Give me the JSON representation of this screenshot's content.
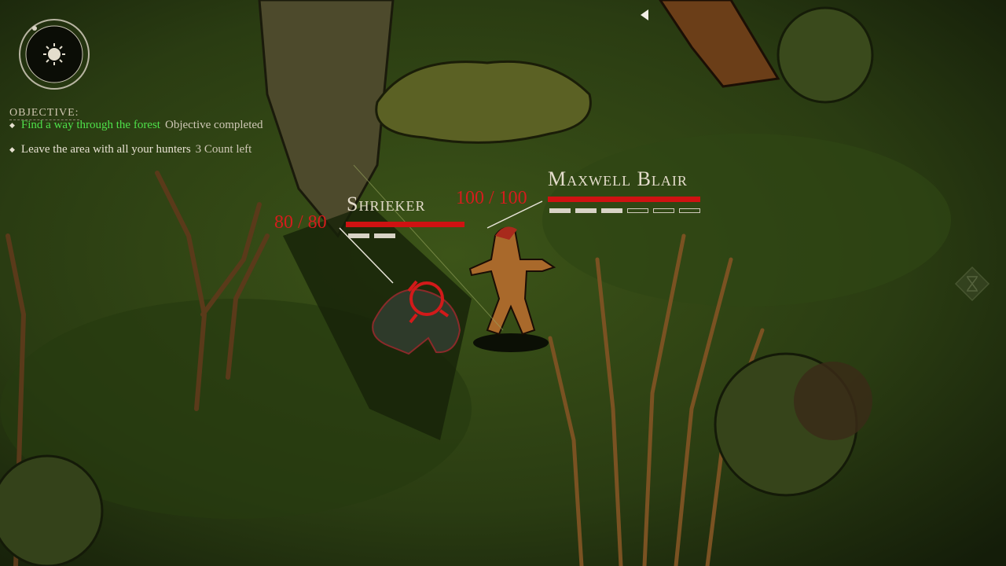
{
  "objectives": {
    "header": "OBJECTIVE:",
    "items": [
      {
        "label": "Find a way through the forest",
        "status": "Objective completed",
        "completed": true
      },
      {
        "label": "Leave the area with all your hunters",
        "status": "3 Count left",
        "completed": false
      }
    ]
  },
  "enemy": {
    "name": "Shrieker",
    "hp_text": "80 / 80",
    "hp": 80,
    "hp_max": 80,
    "action_points": {
      "filled": 2,
      "total": 2
    }
  },
  "hunter": {
    "name": "Maxwell Blair",
    "hp_text": "100 / 100",
    "hp": 100,
    "hp_max": 100,
    "action_points": {
      "filled": 3,
      "total": 6
    }
  },
  "icons": {
    "dial": "sun-icon",
    "back": "back-arrow-icon",
    "cancel": "x-icon"
  },
  "colors": {
    "objective_done": "#4ee04a",
    "health": "#cf1212",
    "text": "#e4dccb"
  }
}
